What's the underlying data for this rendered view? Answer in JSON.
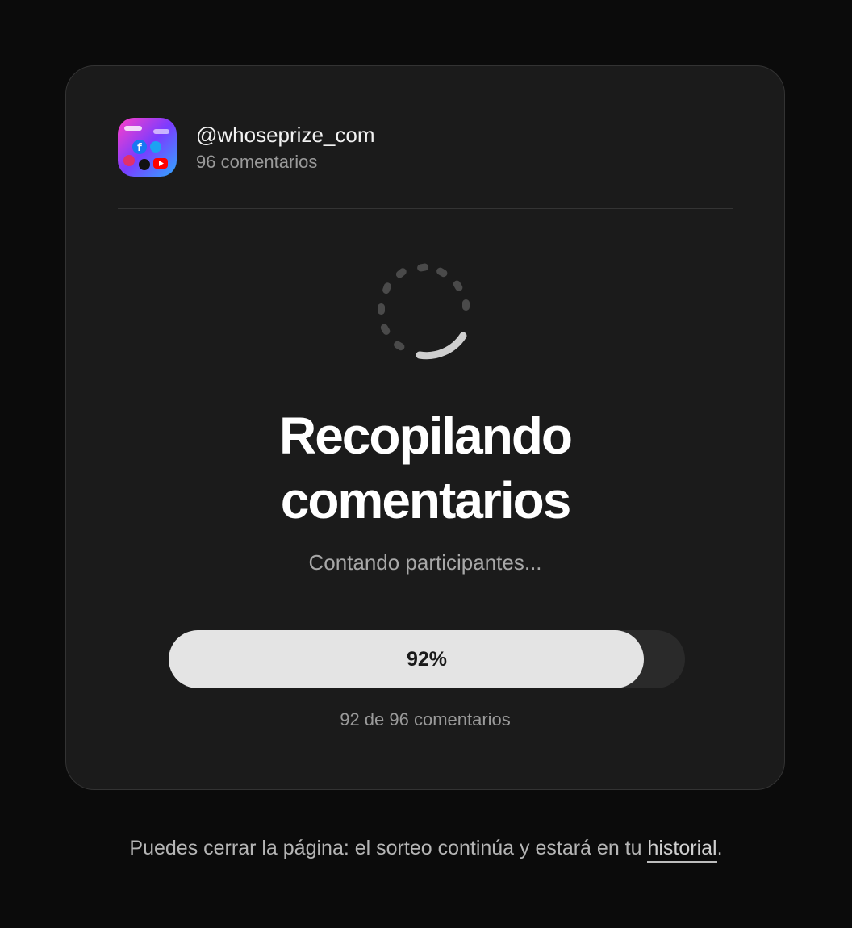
{
  "account": {
    "handle": "@whoseprize_com",
    "comment_count": "96 comentarios",
    "avatar_icon": "social-media-collage-icon"
  },
  "status": {
    "title_line1": "Recopilando",
    "title_line2": "comentarios",
    "subtitle": "Contando participantes..."
  },
  "progress": {
    "value": 0.92,
    "label": "92%",
    "caption": "92 de 96 comentarios"
  },
  "footer": {
    "text": "Puedes cerrar la página: el sorteo continúa y estará en tu ",
    "link": "historial",
    "end": "."
  },
  "colors": {
    "background": "#0b0b0b",
    "card": "#1b1b1b",
    "progress_fill": "#e4e4e4",
    "progress_track": "#2a2a2a"
  }
}
